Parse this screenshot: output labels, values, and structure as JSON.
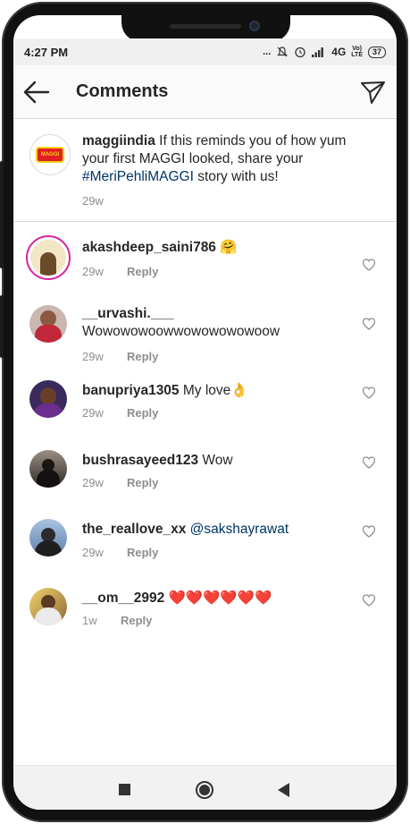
{
  "status_bar": {
    "time": "4:27 PM",
    "dots": "...",
    "network": "4G",
    "volte_top": "Vo)",
    "volte_bottom": "LTE",
    "battery": "37"
  },
  "header": {
    "title": "Comments",
    "back_icon": "arrow-left-icon",
    "send_icon": "paper-plane-icon"
  },
  "caption": {
    "username": "maggiindia",
    "text_before": " If this reminds you of how yum your first MAGGI looked, share your ",
    "hashtag": "#MeriPehliMAGGI",
    "text_after": " story with us!",
    "time": "29w",
    "logo_text": "MAGGI"
  },
  "comments": [
    {
      "username": "akashdeep_saini786",
      "text": " 🤗",
      "mention": "",
      "time": "29w",
      "reply": "Reply"
    },
    {
      "username": "__urvashi.___",
      "text": "Wowowowoowwowowowowoow",
      "mention": "",
      "time": "29w",
      "reply": "Reply"
    },
    {
      "username": "banupriya1305",
      "text": " My love👌",
      "mention": "",
      "time": "29w",
      "reply": "Reply"
    },
    {
      "username": "bushrasayeed123",
      "text": " Wow",
      "mention": "",
      "time": "29w",
      "reply": "Reply"
    },
    {
      "username": "the_reallove_xx",
      "text": " ",
      "mention": "@sakshayrawat",
      "time": "29w",
      "reply": "Reply"
    },
    {
      "username": "__om__2992",
      "text": " ❤️❤️❤️❤️❤️❤️",
      "mention": "",
      "time": "1w",
      "reply": "Reply"
    }
  ],
  "colors": {
    "link": "#003569",
    "muted": "#8e8e8e",
    "text": "#262626",
    "divider": "#dbdbdb"
  }
}
